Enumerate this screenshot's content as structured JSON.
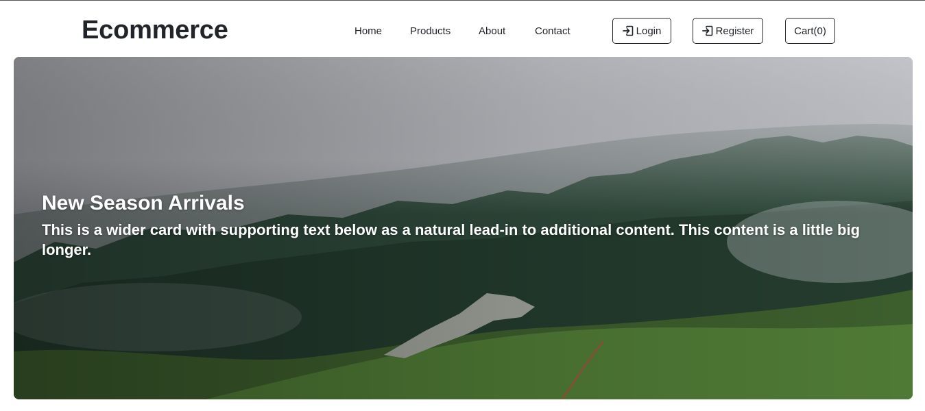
{
  "brand": "Ecommerce",
  "nav": {
    "home": "Home",
    "products": "Products",
    "about": "About",
    "contact": "Contact"
  },
  "actions": {
    "login_label": "Login",
    "register_label": "Register",
    "cart_label": "Cart(0)",
    "login_icon": "box-arrow-in-right-icon",
    "register_icon": "box-arrow-in-right-icon"
  },
  "hero": {
    "title": "New Season Arrivals",
    "description": "This is a wider card with supporting text below as a natural lead-in to additional content. This content is a little big longer."
  },
  "colors": {
    "text": "#212529",
    "hero_text": "#ffffff"
  }
}
